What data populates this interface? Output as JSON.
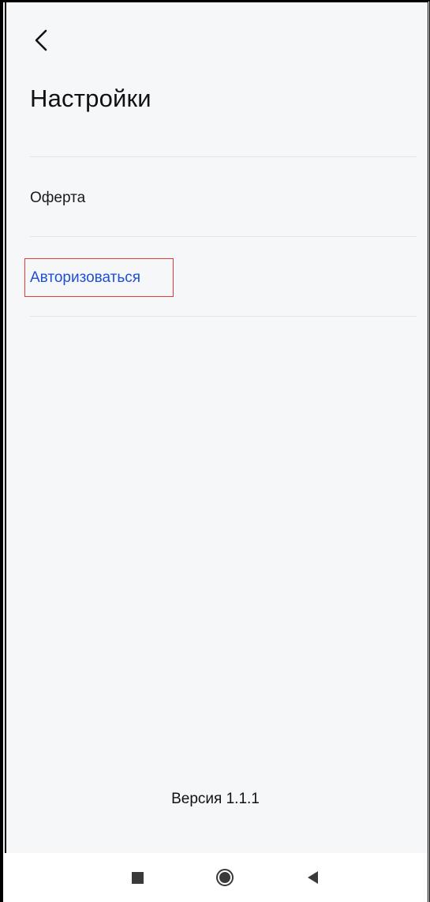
{
  "header": {
    "back_icon": "chevron-left-icon",
    "title": "Настройки"
  },
  "menu": {
    "items": [
      {
        "label": "Оферта"
      },
      {
        "label": "Авторизоваться",
        "color": "#1d4fd8"
      }
    ]
  },
  "footer": {
    "version": "Версия 1.1.1"
  },
  "nav_bar": {
    "recent_icon": "square-icon",
    "home_icon": "circle-home-icon",
    "back_icon": "triangle-back-icon"
  },
  "colors": {
    "background": "#f6f7f9",
    "link": "#1d4fd8",
    "highlight": "#e53935",
    "divider": "#e2e4e8"
  }
}
